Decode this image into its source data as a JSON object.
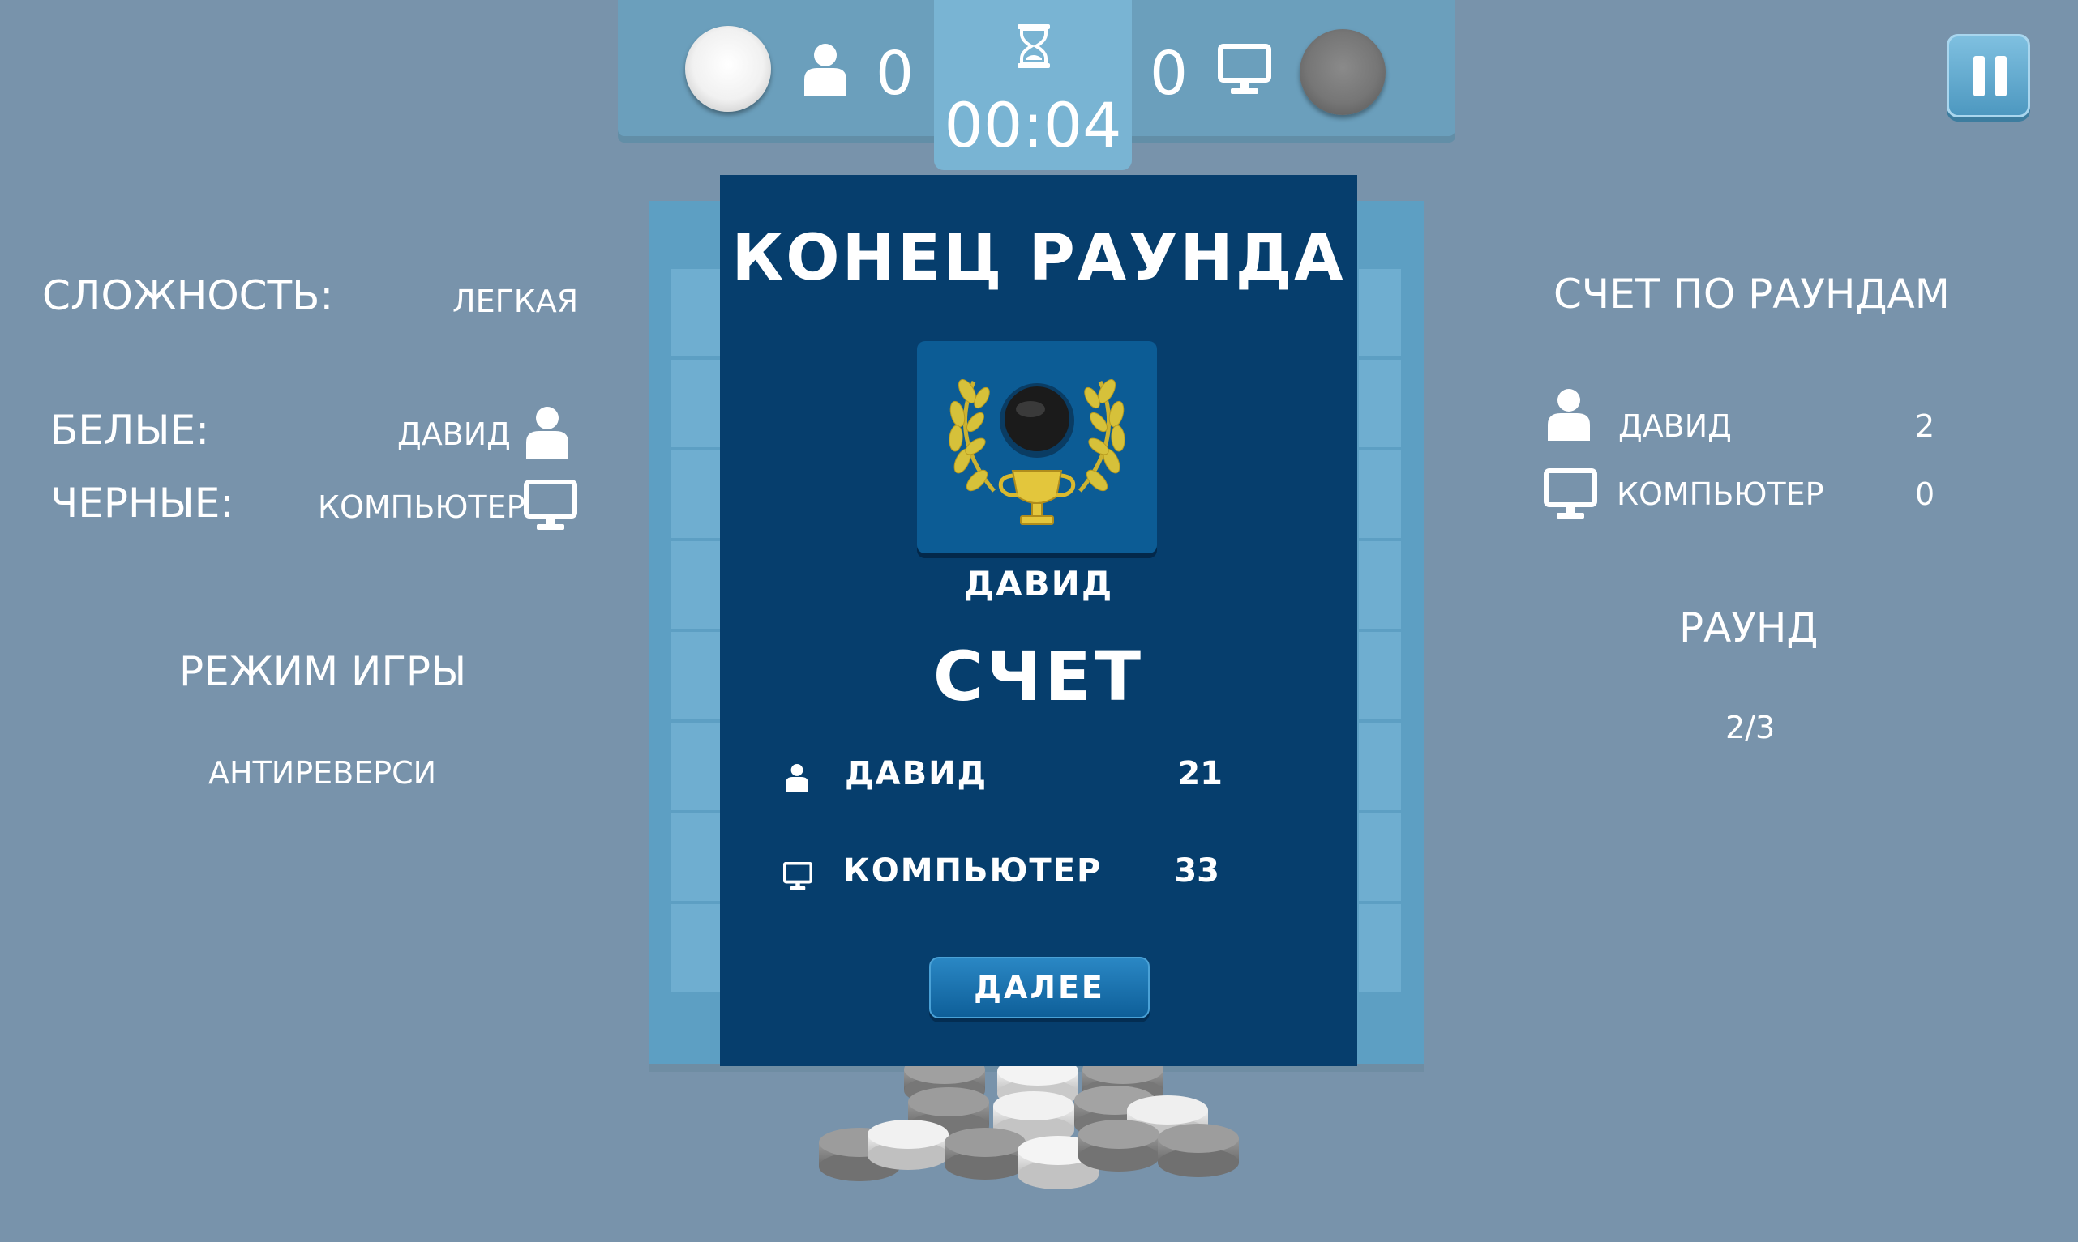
{
  "top": {
    "white_score": "0",
    "black_score": "0",
    "timer": "00:04"
  },
  "dialog": {
    "title": "КОНЕЦ РАУНДА",
    "winner": "ДАВИД",
    "score_title": "СЧЕТ",
    "rows": [
      {
        "name": "ДАВИД",
        "score": "21",
        "icon": "player-icon"
      },
      {
        "name": "КОМПЬЮТЕР",
        "score": "33",
        "icon": "computer-icon"
      }
    ],
    "next_label": "ДАЛЕЕ"
  },
  "left": {
    "difficulty_label": "СЛОЖНОСТЬ:",
    "difficulty_value": "ЛЕГКАЯ",
    "white_label": "БЕЛЫЕ:",
    "white_value": "ДАВИД",
    "black_label": "ЧЕРНЫЕ:",
    "black_value": "КОМПЬЮТЕР",
    "mode_label": "РЕЖИМ ИГРЫ",
    "mode_value": "АНТИРЕВЕРСИ"
  },
  "right": {
    "rounds_title": "СЧЕТ ПО РАУНДАМ",
    "rows": [
      {
        "name": "ДАВИД",
        "score": "2"
      },
      {
        "name": "КОМПЬЮТЕР",
        "score": "0"
      }
    ],
    "round_label": "РАУНД",
    "round_value": "2/3"
  },
  "colors": {
    "background": "#7893ab",
    "dialog": "#063e6d",
    "board": "#5d9fc3"
  }
}
